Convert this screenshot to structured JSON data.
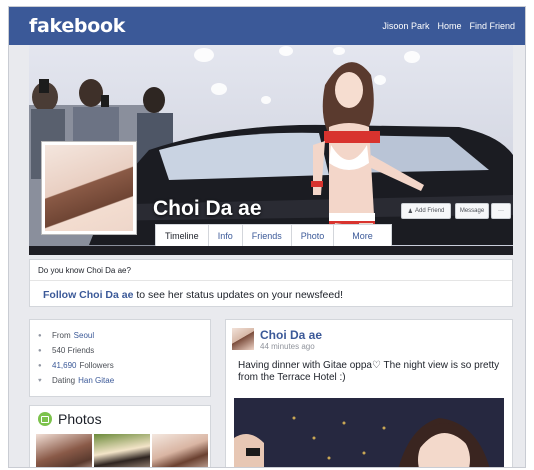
{
  "app": {
    "logo": "fakebook"
  },
  "topnav": {
    "user": "Jisoon Park",
    "home": "Home",
    "find_friend": "Find Friend"
  },
  "profile": {
    "name": "Choi Da ae",
    "add_friend": "Add Friend",
    "message": "Message",
    "more": "···",
    "tabs": [
      "Timeline",
      "Info",
      "Friends",
      "Photo",
      "More"
    ]
  },
  "know_box": {
    "title": "Do you know Choi Da ae?",
    "follow_link": "Follow Choi Da ae",
    "follow_rest": " to see her status updates on your newsfeed!"
  },
  "info": {
    "from_label": "From",
    "from_value": "Seoul",
    "friends": "540 Friends",
    "followers_count": "41,690",
    "followers_label": "Followers",
    "dating_label": "Dating",
    "dating_value": "Han Gitae"
  },
  "photos": {
    "title": "Photos"
  },
  "post": {
    "author": "Choi Da ae",
    "time": "44 minutes ago",
    "text": "Having dinner with Gitae oppa♡ The night view is so pretty from the Terrace Hotel :)"
  },
  "colors": {
    "brand": "#3b5998",
    "accent_green": "#7cc24c"
  }
}
